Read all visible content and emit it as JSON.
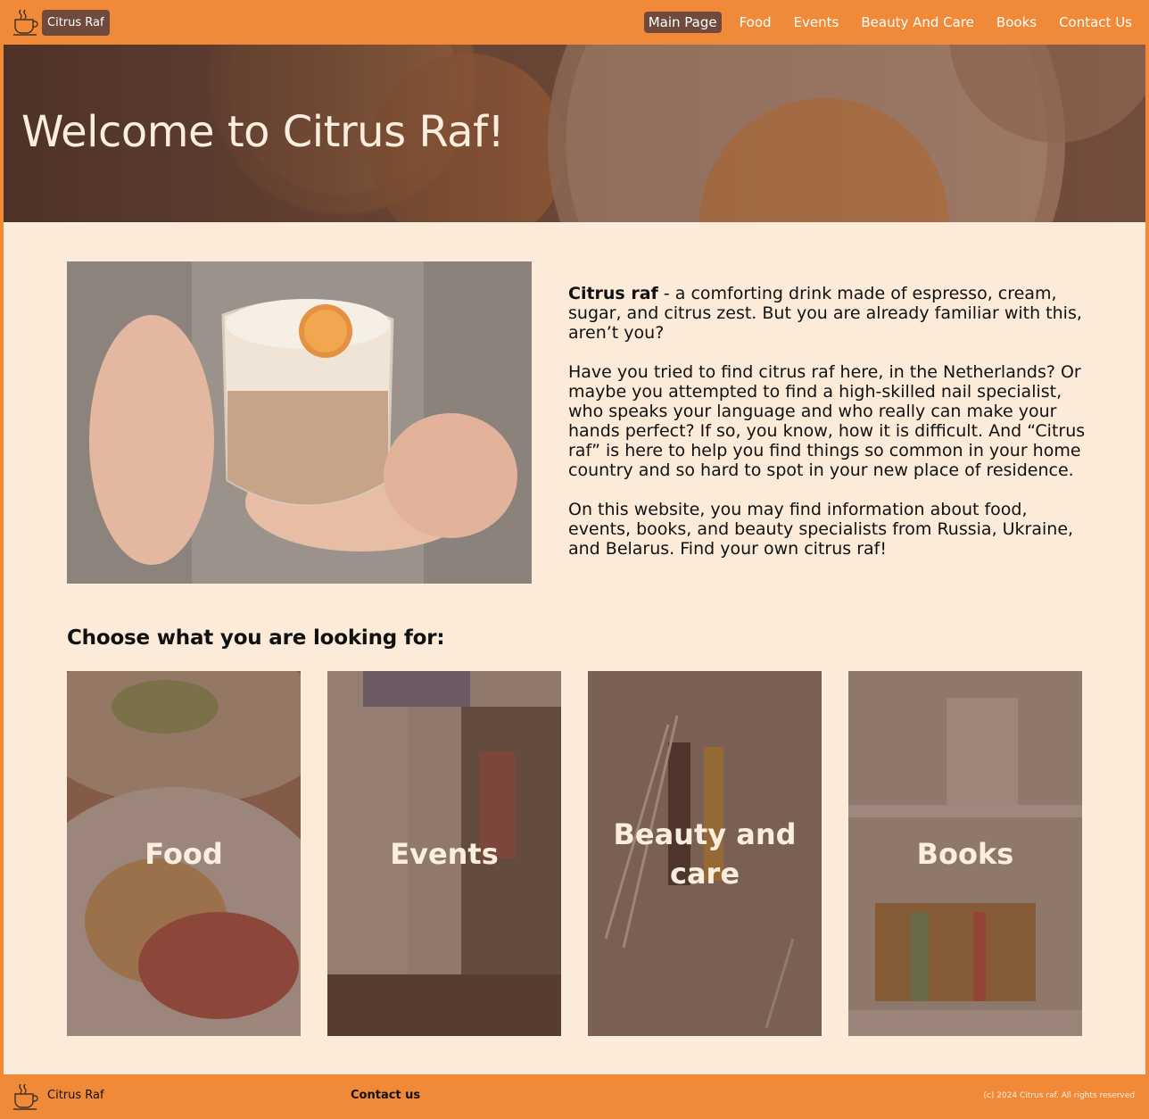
{
  "nav": {
    "brand": "Citrus Raf",
    "links": [
      "Main Page",
      "Food",
      "Events",
      "Beauty And Care",
      "Books",
      "Contact Us"
    ],
    "active_index": 0
  },
  "hero": {
    "title": "Welcome to Citrus Raf!"
  },
  "intro": {
    "bold_lead": "Citrus raf",
    "p1_rest": " - a comforting drink made of espresso, cream, sugar, and citrus zest. But you are already familiar with this, aren’t you?",
    "p2": "Have you tried to find citrus raf here, in the Netherlands? Or maybe you attempted to find a high-skilled nail specialist, who speaks your language and who really can make your hands perfect? If so, you know, how it is difficult. And “Citrus raf” is here to help you find things so common in your home country and so hard to spot in your new place of residence.",
    "p3": "On this website, you may find information about food, events, books, and beauty specialists from Russia, Ukraine, and Belarus. Find your own citrus raf!"
  },
  "choose": {
    "heading": "Choose what you are looking for:",
    "cards": [
      "Food",
      "Events",
      "Beauty and care",
      "Books"
    ]
  },
  "footer": {
    "brand": "Citrus Raf",
    "contact": "Contact us",
    "copyright": "(c) 2024 Citrus raf. All rights reserved"
  },
  "colors": {
    "accent": "#f08a38",
    "brown": "#6f4a3c",
    "background": "#fbebd8"
  },
  "icons": [
    "coffee-cup-icon"
  ]
}
